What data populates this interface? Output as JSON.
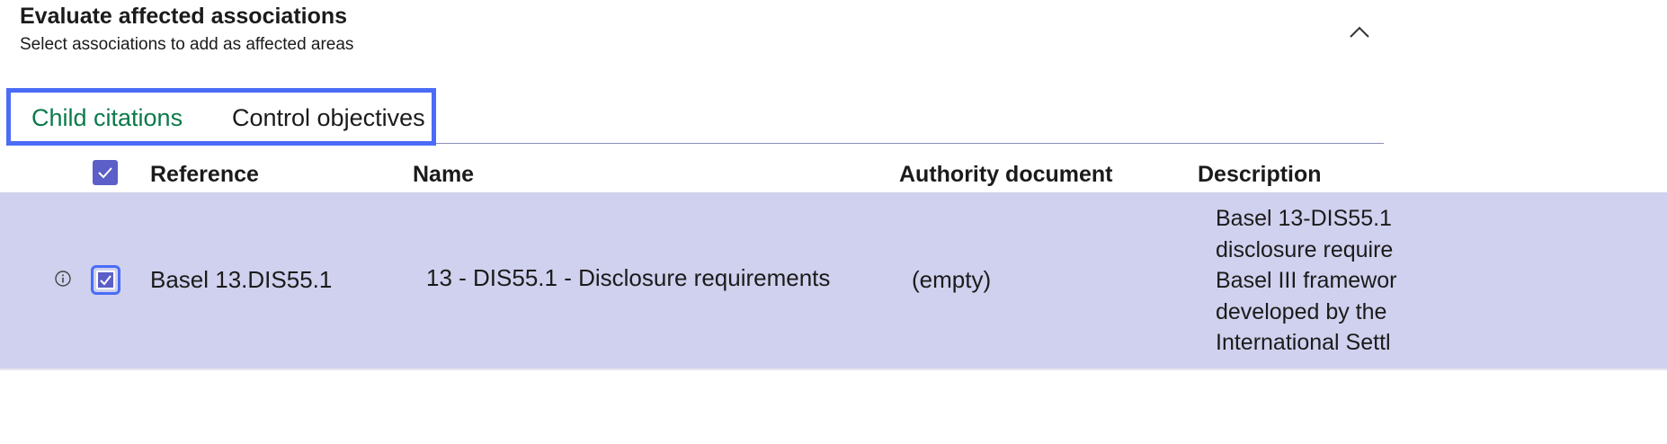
{
  "section": {
    "title": "Evaluate affected associations",
    "subtitle": "Select associations to add as affected areas",
    "collapse_icon": "chevron-up-icon"
  },
  "tabs": [
    {
      "label": "Child citations",
      "active": true
    },
    {
      "label": "Control objectives",
      "active": false
    }
  ],
  "colors": {
    "active_tab": "#0b7a4b",
    "highlight": "#4a6cf7",
    "checkbox": "#5b5fc7",
    "selected_row": "#d0d1ee"
  },
  "table": {
    "select_all_checked": true,
    "columns": [
      "Reference",
      "Name",
      "Authority document",
      "Description"
    ],
    "rows": [
      {
        "selected": true,
        "info_icon": "info-icon",
        "reference": "Basel 13.DIS55.1",
        "name": "13 - DIS55.1 - Disclosure requirements",
        "authority_document": "(empty)",
        "description_lines": [
          "Basel 13-DIS55.1",
          "disclosure require",
          "Basel III framewor",
          "developed by the",
          "International Settl"
        ]
      }
    ]
  }
}
